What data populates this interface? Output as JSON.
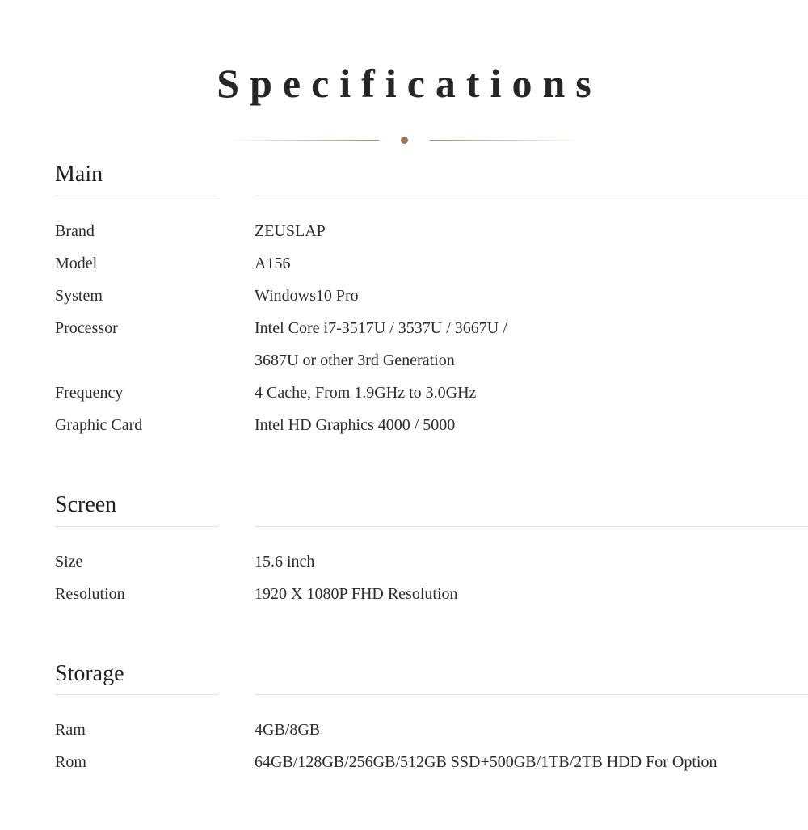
{
  "title": "Specifications",
  "divider": {
    "dot_color": "#a1724a",
    "line_color": "#a1724a"
  },
  "rule_color": "#e4e4e4",
  "sections": [
    {
      "name": "Main",
      "rows": [
        {
          "label": "Brand",
          "value_lines": [
            "ZEUSLAP"
          ]
        },
        {
          "label": "Model",
          "value_lines": [
            "A156"
          ]
        },
        {
          "label": "System",
          "value_lines": [
            "Windows10 Pro"
          ]
        },
        {
          "label": "Processor",
          "value_lines": [
            "Intel Core i7-3517U / 3537U / 3667U /",
            "3687U or other 3rd Generation"
          ]
        },
        {
          "label": "Frequency",
          "value_lines": [
            "4 Cache, From 1.9GHz to 3.0GHz"
          ]
        },
        {
          "label": "Graphic Card",
          "value_lines": [
            "Intel HD Graphics 4000 / 5000"
          ]
        }
      ]
    },
    {
      "name": "Screen",
      "rows": [
        {
          "label": "Size",
          "value_lines": [
            "15.6 inch"
          ]
        },
        {
          "label": "Resolution",
          "value_lines": [
            "1920 X 1080P FHD Resolution"
          ]
        }
      ]
    },
    {
      "name": "Storage",
      "rows": [
        {
          "label": "Ram",
          "value_lines": [
            "4GB/8GB"
          ]
        },
        {
          "label": "Rom",
          "value_lines": [
            "64GB/128GB/256GB/512GB SSD+500GB/1TB/2TB HDD For Option"
          ]
        }
      ]
    }
  ]
}
